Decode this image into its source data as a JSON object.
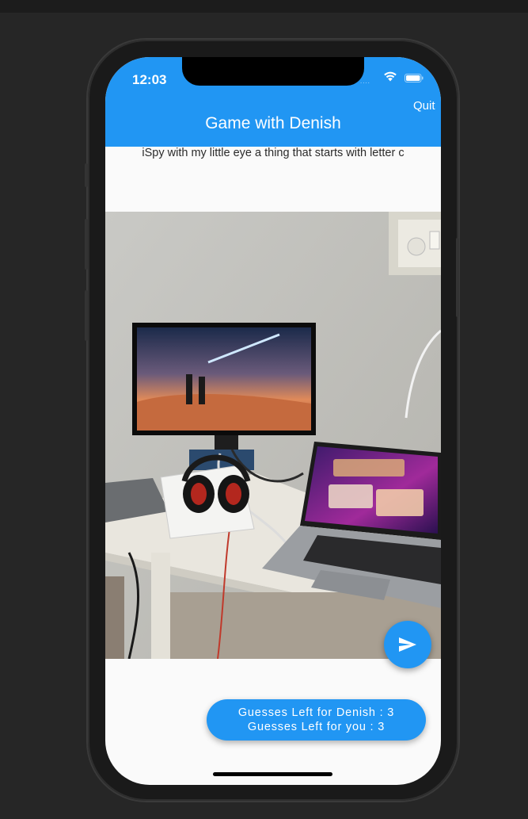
{
  "status_bar": {
    "time": "12:03",
    "signal_dots": "....",
    "wifi_icon": "wifi-icon",
    "battery_icon": "battery-icon"
  },
  "app_bar": {
    "title": "Game with Denish",
    "quit_label": "Quit",
    "color": "#2196f3"
  },
  "prompt": {
    "text": "iSpy with my little eye a thing that starts with letter c"
  },
  "photo": {
    "description_icon": "desk-photo"
  },
  "send_button": {
    "icon": "send-icon"
  },
  "guesses": {
    "opponent": "Guesses Left for Denish : 3",
    "you": "Guesses Left for you : 3"
  }
}
